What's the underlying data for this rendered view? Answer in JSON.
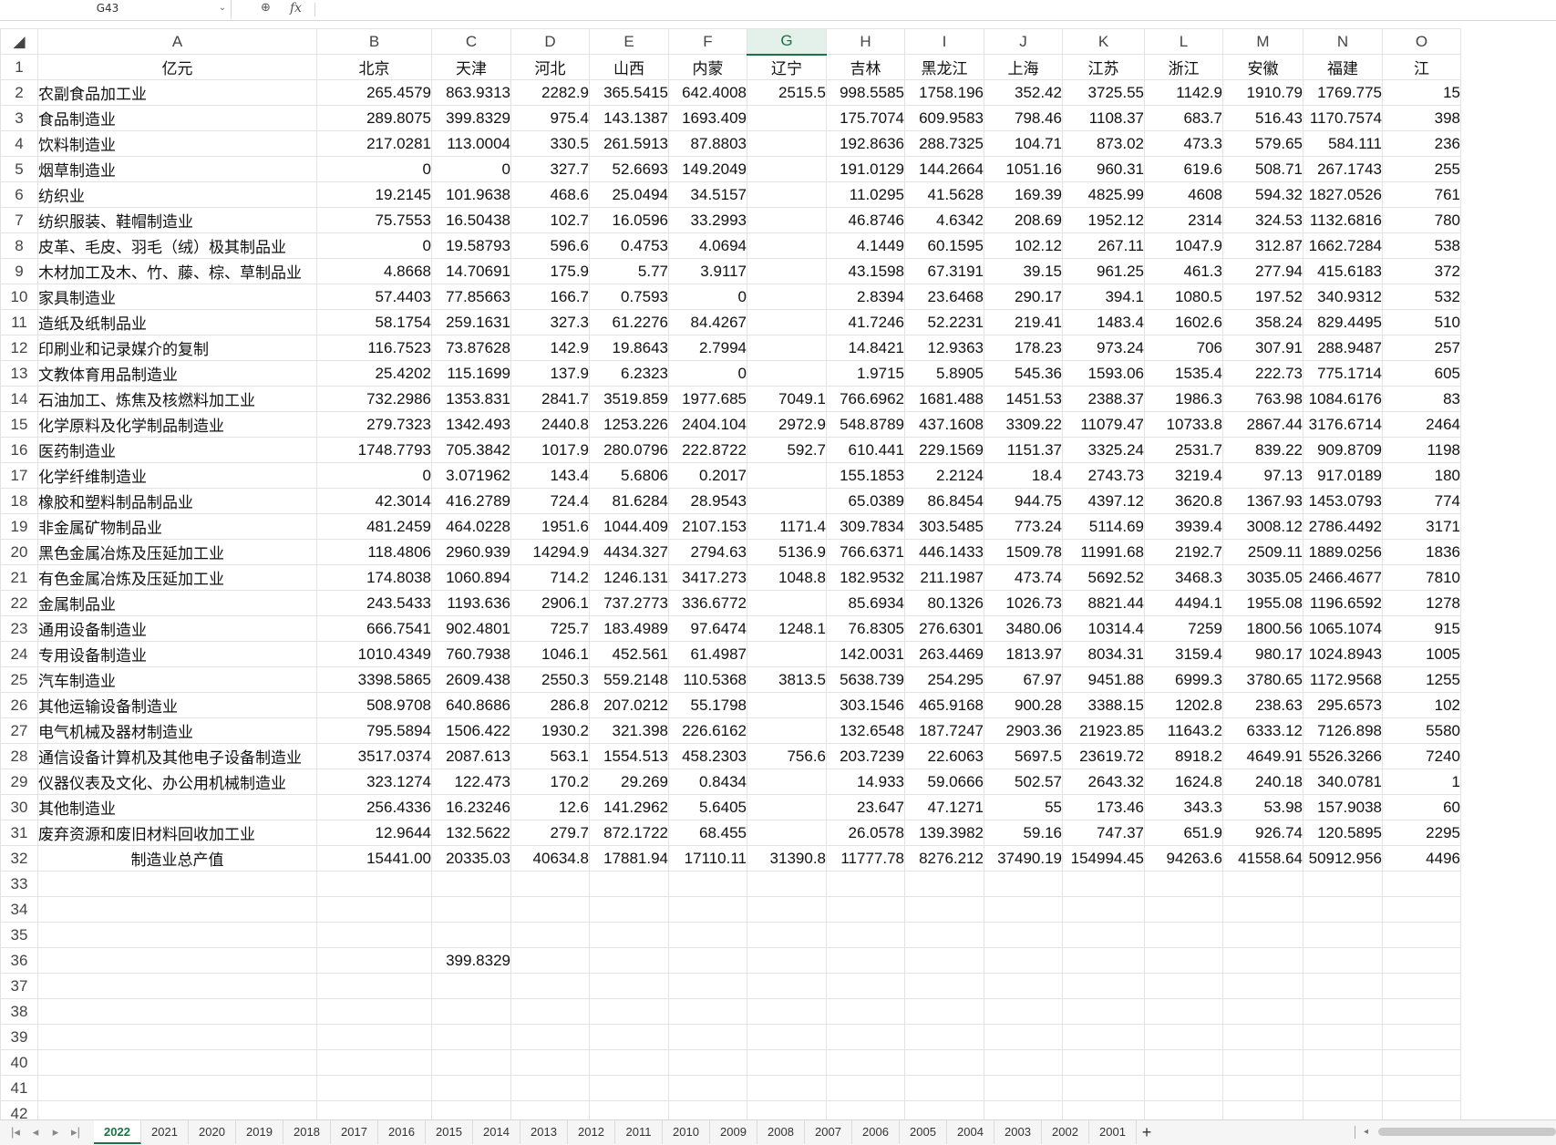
{
  "formula_bar": {
    "name_box": "G43",
    "dropdown_icon": "chevron-down-icon",
    "zoom_icon": "zoom-icon",
    "fx_label": "fx",
    "formula_value": ""
  },
  "corner_glyph": "◢",
  "columns": [
    "A",
    "B",
    "C",
    "D",
    "E",
    "F",
    "G",
    "H",
    "I",
    "J",
    "K",
    "L",
    "M",
    "N",
    "O"
  ],
  "selected_column": "G",
  "rows": [
    [
      "亿元",
      "北京",
      "天津",
      "河北",
      "山西",
      "内蒙",
      "辽宁",
      "吉林",
      "黑龙江",
      "上海",
      "江苏",
      "浙江",
      "安徽",
      "福建",
      "江"
    ],
    [
      "农副食品加工业",
      "265.4579",
      "863.9313",
      "2282.9",
      "365.5415",
      "642.4008",
      "2515.5",
      "998.5585",
      "1758.196",
      "352.42",
      "3725.55",
      "1142.9",
      "1910.79",
      "1769.775",
      "15"
    ],
    [
      "食品制造业",
      "289.8075",
      "399.8329",
      "975.4",
      "143.1387",
      "1693.409",
      "",
      "175.7074",
      "609.9583",
      "798.46",
      "1108.37",
      "683.7",
      "516.43",
      "1170.7574",
      "398"
    ],
    [
      "饮料制造业",
      "217.0281",
      "113.0004",
      "330.5",
      "261.5913",
      "87.8803",
      "",
      "192.8636",
      "288.7325",
      "104.71",
      "873.02",
      "473.3",
      "579.65",
      "584.111",
      "236"
    ],
    [
      "烟草制造业",
      "0",
      "0",
      "327.7",
      "52.6693",
      "149.2049",
      "",
      "191.0129",
      "144.2664",
      "1051.16",
      "960.31",
      "619.6",
      "508.71",
      "267.1743",
      "255"
    ],
    [
      "纺织业",
      "19.2145",
      "101.9638",
      "468.6",
      "25.0494",
      "34.5157",
      "",
      "11.0295",
      "41.5628",
      "169.39",
      "4825.99",
      "4608",
      "594.32",
      "1827.0526",
      "761"
    ],
    [
      "纺织服装、鞋帽制造业",
      "75.7553",
      "16.50438",
      "102.7",
      "16.0596",
      "33.2993",
      "",
      "46.8746",
      "4.6342",
      "208.69",
      "1952.12",
      "2314",
      "324.53",
      "1132.6816",
      "780"
    ],
    [
      "皮革、毛皮、羽毛（绒）极其制品业",
      "0",
      "19.58793",
      "596.6",
      "0.4753",
      "4.0694",
      "",
      "4.1449",
      "60.1595",
      "102.12",
      "267.11",
      "1047.9",
      "312.87",
      "1662.7284",
      "538"
    ],
    [
      "木材加工及木、竹、藤、棕、草制品业",
      "4.8668",
      "14.70691",
      "175.9",
      "5.77",
      "3.9117",
      "",
      "43.1598",
      "67.3191",
      "39.15",
      "961.25",
      "461.3",
      "277.94",
      "415.6183",
      "372"
    ],
    [
      "家具制造业",
      "57.4403",
      "77.85663",
      "166.7",
      "0.7593",
      "0",
      "",
      "2.8394",
      "23.6468",
      "290.17",
      "394.1",
      "1080.5",
      "197.52",
      "340.9312",
      "532"
    ],
    [
      "造纸及纸制品业",
      "58.1754",
      "259.1631",
      "327.3",
      "61.2276",
      "84.4267",
      "",
      "41.7246",
      "52.2231",
      "219.41",
      "1483.4",
      "1602.6",
      "358.24",
      "829.4495",
      "510"
    ],
    [
      "印刷业和记录媒介的复制",
      "116.7523",
      "73.87628",
      "142.9",
      "19.8643",
      "2.7994",
      "",
      "14.8421",
      "12.9363",
      "178.23",
      "973.24",
      "706",
      "307.91",
      "288.9487",
      "257"
    ],
    [
      "文教体育用品制造业",
      "25.4202",
      "115.1699",
      "137.9",
      "6.2323",
      "0",
      "",
      "1.9715",
      "5.8905",
      "545.36",
      "1593.06",
      "1535.4",
      "222.73",
      "775.1714",
      "605"
    ],
    [
      "石油加工、炼焦及核燃料加工业",
      "732.2986",
      "1353.831",
      "2841.7",
      "3519.859",
      "1977.685",
      "7049.1",
      "766.6962",
      "1681.488",
      "1451.53",
      "2388.37",
      "1986.3",
      "763.98",
      "1084.6176",
      "83"
    ],
    [
      "化学原料及化学制品制造业",
      "279.7323",
      "1342.493",
      "2440.8",
      "1253.226",
      "2404.104",
      "2972.9",
      "548.8789",
      "437.1608",
      "3309.22",
      "11079.47",
      "10733.8",
      "2867.44",
      "3176.6714",
      "2464"
    ],
    [
      "医药制造业",
      "1748.7793",
      "705.3842",
      "1017.9",
      "280.0796",
      "222.8722",
      "592.7",
      "610.441",
      "229.1569",
      "1151.37",
      "3325.24",
      "2531.7",
      "839.22",
      "909.8709",
      "1198"
    ],
    [
      "化学纤维制造业",
      "0",
      "3.071962",
      "143.4",
      "5.6806",
      "0.2017",
      "",
      "155.1853",
      "2.2124",
      "18.4",
      "2743.73",
      "3219.4",
      "97.13",
      "917.0189",
      "180"
    ],
    [
      "橡胶和塑料制品制品业",
      "42.3014",
      "416.2789",
      "724.4",
      "81.6284",
      "28.9543",
      "",
      "65.0389",
      "86.8454",
      "944.75",
      "4397.12",
      "3620.8",
      "1367.93",
      "1453.0793",
      "774"
    ],
    [
      "非金属矿物制品业",
      "481.2459",
      "464.0228",
      "1951.6",
      "1044.409",
      "2107.153",
      "1171.4",
      "309.7834",
      "303.5485",
      "773.24",
      "5114.69",
      "3939.4",
      "3008.12",
      "2786.4492",
      "3171"
    ],
    [
      "黑色金属冶炼及压延加工业",
      "118.4806",
      "2960.939",
      "14294.9",
      "4434.327",
      "2794.63",
      "5136.9",
      "766.6371",
      "446.1433",
      "1509.78",
      "11991.68",
      "2192.7",
      "2509.11",
      "1889.0256",
      "1836"
    ],
    [
      "有色金属冶炼及压延加工业",
      "174.8038",
      "1060.894",
      "714.2",
      "1246.131",
      "3417.273",
      "1048.8",
      "182.9532",
      "211.1987",
      "473.74",
      "5692.52",
      "3468.3",
      "3035.05",
      "2466.4677",
      "7810"
    ],
    [
      "金属制品业",
      "243.5433",
      "1193.636",
      "2906.1",
      "737.2773",
      "336.6772",
      "",
      "85.6934",
      "80.1326",
      "1026.73",
      "8821.44",
      "4494.1",
      "1955.08",
      "1196.6592",
      "1278"
    ],
    [
      "通用设备制造业",
      "666.7541",
      "902.4801",
      "725.7",
      "183.4989",
      "97.6474",
      "1248.1",
      "76.8305",
      "276.6301",
      "3480.06",
      "10314.4",
      "7259",
      "1800.56",
      "1065.1074",
      "915"
    ],
    [
      "专用设备制造业",
      "1010.4349",
      "760.7938",
      "1046.1",
      "452.561",
      "61.4987",
      "",
      "142.0031",
      "263.4469",
      "1813.97",
      "8034.31",
      "3159.4",
      "980.17",
      "1024.8943",
      "1005"
    ],
    [
      "汽车制造业",
      "3398.5865",
      "2609.438",
      "2550.3",
      "559.2148",
      "110.5368",
      "3813.5",
      "5638.739",
      "254.295",
      "67.97",
      "9451.88",
      "6999.3",
      "3780.65",
      "1172.9568",
      "1255"
    ],
    [
      "其他运输设备制造业",
      "508.9708",
      "640.8686",
      "286.8",
      "207.0212",
      "55.1798",
      "",
      "303.1546",
      "465.9168",
      "900.28",
      "3388.15",
      "1202.8",
      "238.63",
      "295.6573",
      "102"
    ],
    [
      "电气机械及器材制造业",
      "795.5894",
      "1506.422",
      "1930.2",
      "321.398",
      "226.6162",
      "",
      "132.6548",
      "187.7247",
      "2903.36",
      "21923.85",
      "11643.2",
      "6333.12",
      "7126.898",
      "5580"
    ],
    [
      "通信设备计算机及其他电子设备制造业",
      "3517.0374",
      "2087.613",
      "563.1",
      "1554.513",
      "458.2303",
      "756.6",
      "203.7239",
      "22.6063",
      "5697.5",
      "23619.72",
      "8918.2",
      "4649.91",
      "5526.3266",
      "7240"
    ],
    [
      "仪器仪表及文化、办公用机械制造业",
      "323.1274",
      "122.473",
      "170.2",
      "29.269",
      "0.8434",
      "",
      "14.933",
      "59.0666",
      "502.57",
      "2643.32",
      "1624.8",
      "240.18",
      "340.0781",
      "1"
    ],
    [
      "其他制造业",
      "256.4336",
      "16.23246",
      "12.6",
      "141.2962",
      "5.6405",
      "",
      "23.647",
      "47.1271",
      "55",
      "173.46",
      "343.3",
      "53.98",
      "157.9038",
      "60"
    ],
    [
      "废弃资源和废旧材料回收加工业",
      "12.9644",
      "132.5622",
      "279.7",
      "872.1722",
      "68.455",
      "",
      "26.0578",
      "139.3982",
      "59.16",
      "747.37",
      "651.9",
      "926.74",
      "120.5895",
      "2295"
    ],
    [
      "制造业总产值",
      "15441.00",
      "20335.03",
      "40634.8",
      "17881.94",
      "17110.11",
      "31390.8",
      "11777.78",
      "8276.212",
      "37490.19",
      "154994.45",
      "94263.6",
      "41558.64",
      "50912.956",
      "4496"
    ],
    [
      "",
      "",
      "",
      "",
      "",
      "",
      "",
      "",
      "",
      "",
      "",
      "",
      "",
      "",
      ""
    ],
    [
      "",
      "",
      "",
      "",
      "",
      "",
      "",
      "",
      "",
      "",
      "",
      "",
      "",
      "",
      ""
    ],
    [
      "",
      "",
      "",
      "",
      "",
      "",
      "",
      "",
      "",
      "",
      "",
      "",
      "",
      "",
      ""
    ],
    [
      "",
      "",
      "399.8329",
      "",
      "",
      "",
      "",
      "",
      "",
      "",
      "",
      "",
      "",
      "",
      ""
    ],
    [
      "",
      "",
      "",
      "",
      "",
      "",
      "",
      "",
      "",
      "",
      "",
      "",
      "",
      "",
      ""
    ],
    [
      "",
      "",
      "",
      "",
      "",
      "",
      "",
      "",
      "",
      "",
      "",
      "",
      "",
      "",
      ""
    ],
    [
      "",
      "",
      "",
      "",
      "",
      "",
      "",
      "",
      "",
      "",
      "",
      "",
      "",
      "",
      ""
    ],
    [
      "",
      "",
      "",
      "",
      "",
      "",
      "",
      "",
      "",
      "",
      "",
      "",
      "",
      "",
      ""
    ],
    [
      "",
      "",
      "",
      "",
      "",
      "",
      "",
      "",
      "",
      "",
      "",
      "",
      "",
      "",
      ""
    ],
    [
      "",
      "",
      "",
      "",
      "",
      "",
      "",
      "",
      "",
      "",
      "",
      "",
      "",
      "",
      ""
    ]
  ],
  "sheet_tabs": [
    "2022",
    "2021",
    "2020",
    "2019",
    "2018",
    "2017",
    "2016",
    "2015",
    "2014",
    "2013",
    "2012",
    "2011",
    "2010",
    "2009",
    "2008",
    "2007",
    "2006",
    "2005",
    "2004",
    "2003",
    "2002",
    "2001"
  ],
  "active_tab": "2022",
  "nav_arrows": [
    "|◂",
    "◂",
    "▸",
    "▸|"
  ],
  "add_sheet_label": "+",
  "colors": {
    "accent": "#1e7145",
    "grid": "#e3e3e3",
    "tab_bar": "#f5f5f5"
  }
}
